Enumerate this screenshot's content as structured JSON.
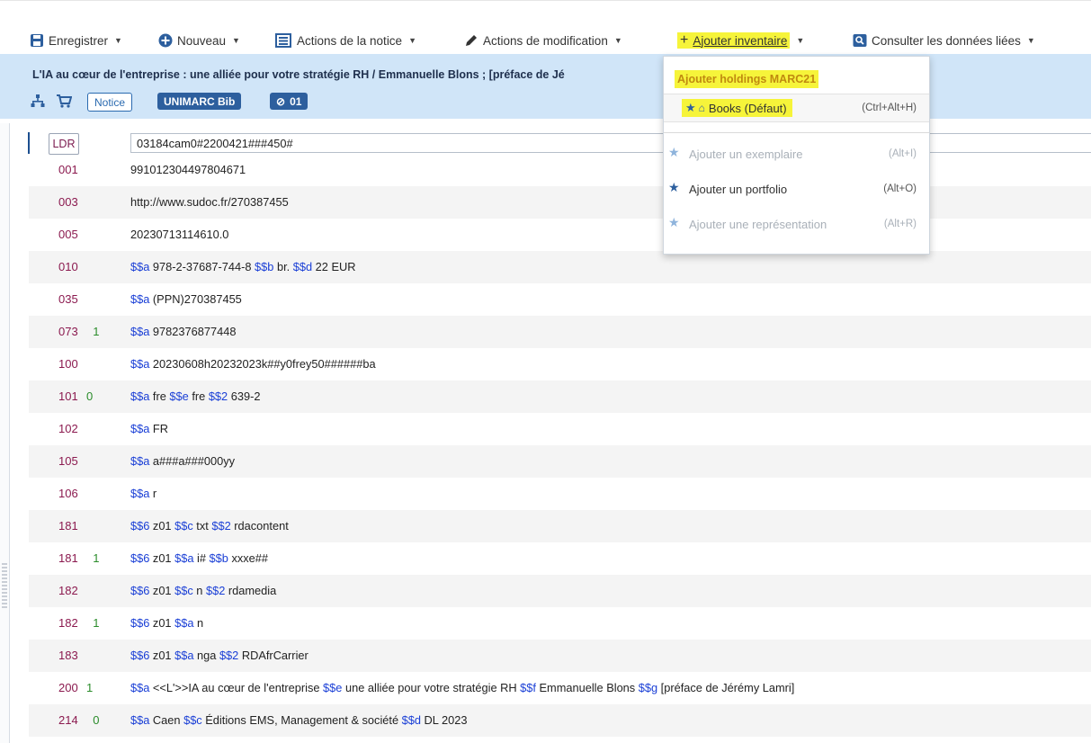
{
  "toolbar": {
    "save": "Enregistrer",
    "new": "Nouveau",
    "record_actions": "Actions de la notice",
    "edit_actions": "Actions de modification",
    "add_inventory": "Ajouter inventaire",
    "linked_data": "Consulter les données liées",
    "highlight_color": "#f6f43a"
  },
  "record": {
    "title": "L'IA au cœur de l'entreprise : une alliée pour votre stratégie RH / Emmanuelle Blons ; [préface de Jé",
    "tag_notice": "Notice",
    "tag_format": "UNIMARC Bib",
    "tag_number": "01"
  },
  "dropdown": {
    "header": "Ajouter holdings MARC21",
    "books_label": "Books (Défaut)",
    "books_shortcut": "(Ctrl+Alt+H)",
    "item_label": "Ajouter un exemplaire",
    "item_shortcut": "(Alt+I)",
    "portfolio_label": "Ajouter un portfolio",
    "portfolio_shortcut": "(Alt+O)",
    "representation_label": "Ajouter une représentation",
    "representation_shortcut": "(Alt+R)"
  },
  "ldr": {
    "label": "LDR",
    "value": "03184cam0#2200421###450#"
  },
  "fields": [
    {
      "tag": "001",
      "ind": "",
      "parts": [
        {
          "t": "991012304497804671",
          "sf": false
        }
      ]
    },
    {
      "tag": "003",
      "ind": "",
      "parts": [
        {
          "t": "http://www.sudoc.fr/270387455",
          "sf": false
        }
      ]
    },
    {
      "tag": "005",
      "ind": "",
      "parts": [
        {
          "t": "20230713114610.0",
          "sf": false
        }
      ]
    },
    {
      "tag": "010",
      "ind": "",
      "parts": [
        {
          "t": "$$a",
          "sf": true
        },
        {
          "t": " 978-2-37687-744-8 ",
          "sf": false
        },
        {
          "t": "$$b",
          "sf": true
        },
        {
          "t": " br. ",
          "sf": false
        },
        {
          "t": "$$d",
          "sf": true
        },
        {
          "t": " 22 EUR",
          "sf": false
        }
      ]
    },
    {
      "tag": "035",
      "ind": "",
      "parts": [
        {
          "t": "$$a",
          "sf": true
        },
        {
          "t": " (PPN)270387455",
          "sf": false
        }
      ]
    },
    {
      "tag": "073",
      "ind": "  1",
      "parts": [
        {
          "t": "$$a",
          "sf": true
        },
        {
          "t": " 9782376877448",
          "sf": false
        }
      ]
    },
    {
      "tag": "100",
      "ind": "",
      "parts": [
        {
          "t": "$$a",
          "sf": true
        },
        {
          "t": " 20230608h20232023k##y0frey50######ba",
          "sf": false
        }
      ]
    },
    {
      "tag": "101",
      "ind": "0",
      "parts": [
        {
          "t": "$$a",
          "sf": true
        },
        {
          "t": " fre ",
          "sf": false
        },
        {
          "t": "$$e",
          "sf": true
        },
        {
          "t": " fre ",
          "sf": false
        },
        {
          "t": "$$2",
          "sf": true
        },
        {
          "t": " 639-2",
          "sf": false
        }
      ]
    },
    {
      "tag": "102",
      "ind": "",
      "parts": [
        {
          "t": "$$a",
          "sf": true
        },
        {
          "t": " FR",
          "sf": false
        }
      ]
    },
    {
      "tag": "105",
      "ind": "",
      "parts": [
        {
          "t": "$$a",
          "sf": true
        },
        {
          "t": " a###a###000yy",
          "sf": false
        }
      ]
    },
    {
      "tag": "106",
      "ind": "",
      "parts": [
        {
          "t": "$$a",
          "sf": true
        },
        {
          "t": " r",
          "sf": false
        }
      ]
    },
    {
      "tag": "181",
      "ind": "",
      "parts": [
        {
          "t": "$$6",
          "sf": true
        },
        {
          "t": " z01 ",
          "sf": false
        },
        {
          "t": "$$c",
          "sf": true
        },
        {
          "t": " txt ",
          "sf": false
        },
        {
          "t": "$$2",
          "sf": true
        },
        {
          "t": " rdacontent",
          "sf": false
        }
      ]
    },
    {
      "tag": "181",
      "ind": "  1",
      "parts": [
        {
          "t": "$$6",
          "sf": true
        },
        {
          "t": " z01 ",
          "sf": false
        },
        {
          "t": "$$a",
          "sf": true
        },
        {
          "t": " i# ",
          "sf": false
        },
        {
          "t": "$$b",
          "sf": true
        },
        {
          "t": " xxxe##",
          "sf": false
        }
      ]
    },
    {
      "tag": "182",
      "ind": "",
      "parts": [
        {
          "t": "$$6",
          "sf": true
        },
        {
          "t": " z01 ",
          "sf": false
        },
        {
          "t": "$$c",
          "sf": true
        },
        {
          "t": " n ",
          "sf": false
        },
        {
          "t": "$$2",
          "sf": true
        },
        {
          "t": " rdamedia",
          "sf": false
        }
      ]
    },
    {
      "tag": "182",
      "ind": "  1",
      "parts": [
        {
          "t": "$$6",
          "sf": true
        },
        {
          "t": " z01 ",
          "sf": false
        },
        {
          "t": "$$a",
          "sf": true
        },
        {
          "t": " n",
          "sf": false
        }
      ]
    },
    {
      "tag": "183",
      "ind": "",
      "parts": [
        {
          "t": "$$6",
          "sf": true
        },
        {
          "t": " z01 ",
          "sf": false
        },
        {
          "t": "$$a",
          "sf": true
        },
        {
          "t": " nga ",
          "sf": false
        },
        {
          "t": "$$2",
          "sf": true
        },
        {
          "t": " RDAfrCarrier",
          "sf": false
        }
      ]
    },
    {
      "tag": "200",
      "ind": "1",
      "parts": [
        {
          "t": "$$a",
          "sf": true
        },
        {
          "t": " <<L'>>IA au cœur de l'entreprise ",
          "sf": false
        },
        {
          "t": "$$e",
          "sf": true
        },
        {
          "t": " une alliée pour votre stratégie RH ",
          "sf": false
        },
        {
          "t": "$$f",
          "sf": true
        },
        {
          "t": " Emmanuelle Blons ",
          "sf": false
        },
        {
          "t": "$$g",
          "sf": true
        },
        {
          "t": " [préface de Jérémy Lamri]",
          "sf": false
        }
      ]
    },
    {
      "tag": "214",
      "ind": "  0",
      "parts": [
        {
          "t": "$$a",
          "sf": true
        },
        {
          "t": " Caen ",
          "sf": false
        },
        {
          "t": "$$c",
          "sf": true
        },
        {
          "t": " Éditions EMS, Management & société ",
          "sf": false
        },
        {
          "t": "$$d",
          "sf": true
        },
        {
          "t": " DL 2023",
          "sf": false
        }
      ]
    }
  ]
}
